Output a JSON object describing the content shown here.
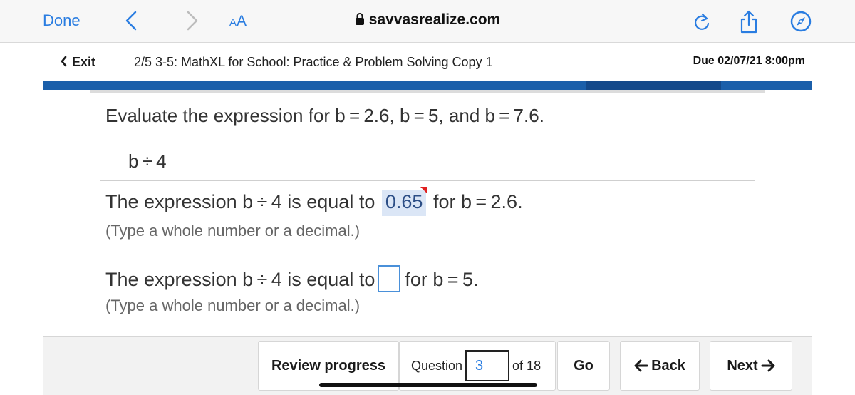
{
  "browser": {
    "done_label": "Done",
    "text_size_small": "A",
    "text_size_big": "A",
    "domain": "savvasrealize.com",
    "accent_color": "#2a7de1"
  },
  "header": {
    "exit_label": "Exit",
    "assignment_title": "2/5 3-5: MathXL for School: Practice & Problem Solving Copy 1",
    "due": "Due 02/07/21 8:00pm",
    "band_color": "#1b5faa"
  },
  "question": {
    "prompt": "Evaluate the expression for b = 2.6, b = 5, and b = 7.6.",
    "expression": "b ÷ 4",
    "part1": {
      "before": "The expression b ÷ 4 is equal to",
      "answer": "0.65",
      "after": "for b = 2.6.",
      "hint": "(Type a whole number or a decimal.)"
    },
    "part2": {
      "before": "The expression b ÷ 4 is equal to",
      "answer": "",
      "after": "for b = 5.",
      "hint": "(Type a whole number or a decimal.)"
    }
  },
  "toolbar": {
    "review_label": "Review progress",
    "question_label": "Question",
    "question_number": "3",
    "of_total": "of 18",
    "go_label": "Go",
    "back_label": "Back",
    "next_label": "Next",
    "back_arrow": "🡸",
    "next_arrow": "🡺"
  }
}
